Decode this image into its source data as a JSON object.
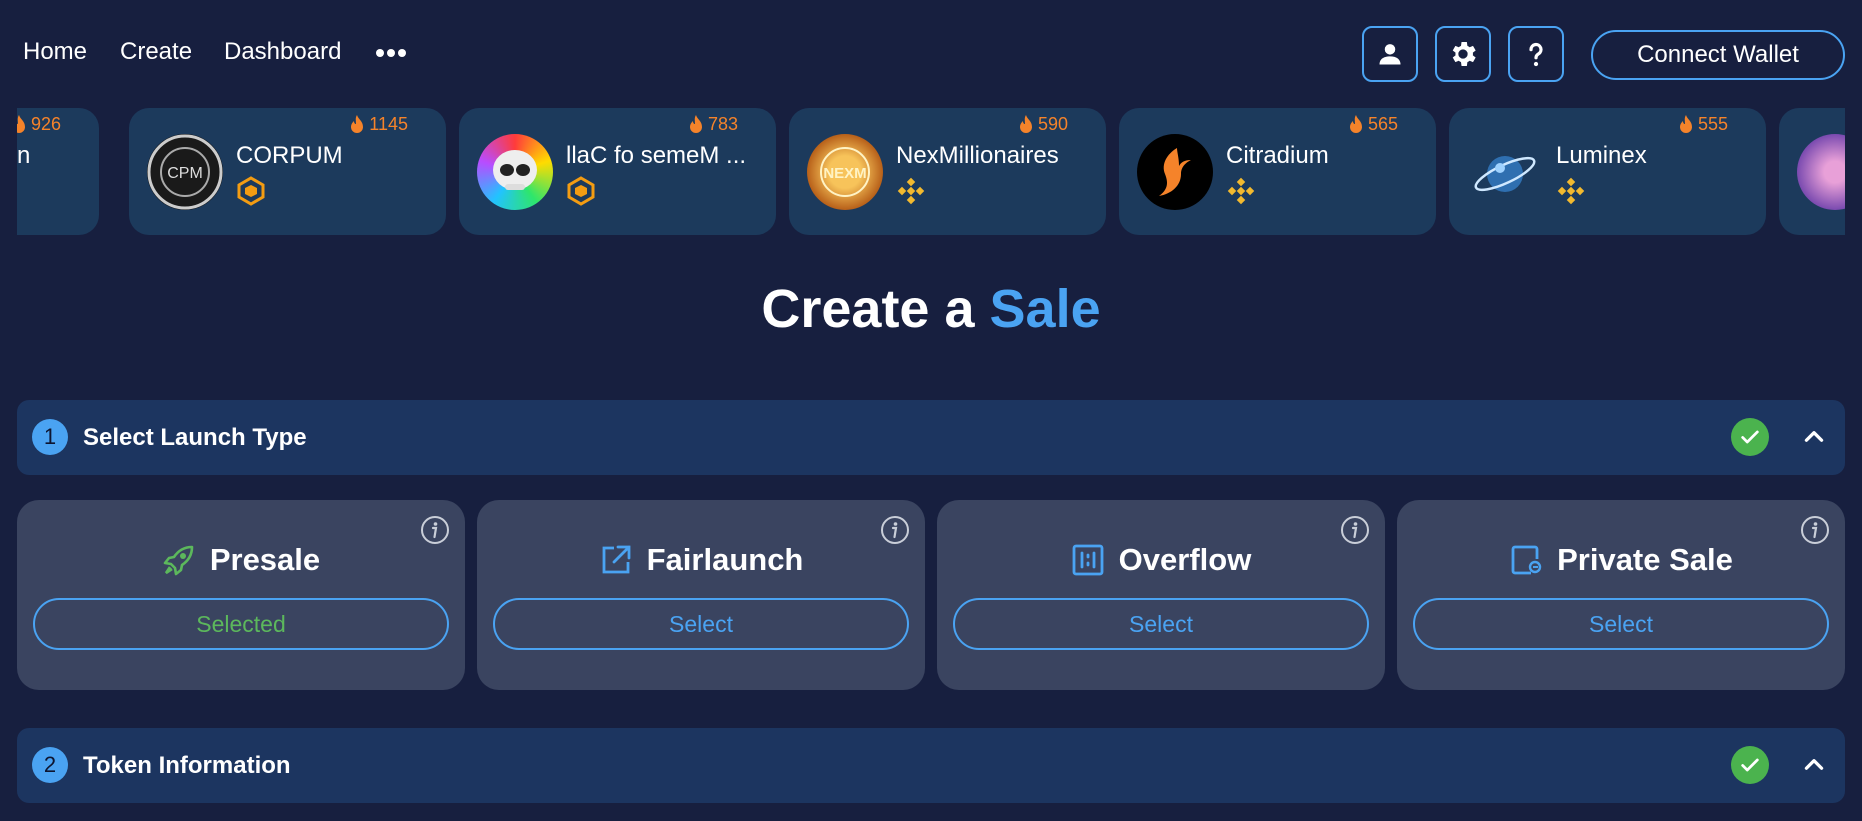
{
  "nav": {
    "links": [
      "Home",
      "Create",
      "Dashboard"
    ],
    "more_icon": "ellipsis-icon",
    "icons": [
      "user-icon",
      "gear-icon",
      "help-icon"
    ],
    "connect_wallet": "Connect Wallet"
  },
  "trending": [
    {
      "name": "n",
      "count": "926",
      "chain_icon": "chain-icon"
    },
    {
      "name": "CORPUM",
      "count": "1145",
      "chain_icon": "chain-icon"
    },
    {
      "name": "llaC fo semeM ...",
      "count": "783",
      "chain_icon": "chain-icon"
    },
    {
      "name": "NexMillionaires",
      "count": "590",
      "chain_icon": "bnb-icon"
    },
    {
      "name": "Citradium",
      "count": "565",
      "chain_icon": "bnb-icon"
    },
    {
      "name": "Luminex",
      "count": "555",
      "chain_icon": "bnb-icon"
    }
  ],
  "title": {
    "part1": "Create a ",
    "accent": "Sale"
  },
  "sections": [
    {
      "step": "1",
      "title": "Select Launch Type",
      "completed": true
    },
    {
      "step": "2",
      "title": "Token Information",
      "completed": true
    }
  ],
  "launch_types": [
    {
      "name": "Presale",
      "button": "Selected",
      "icon": "rocket-icon",
      "selected": true
    },
    {
      "name": "Fairlaunch",
      "button": "Select",
      "icon": "external-link-icon",
      "selected": false
    },
    {
      "name": "Overflow",
      "button": "Select",
      "icon": "overflow-icon",
      "selected": false
    },
    {
      "name": "Private Sale",
      "button": "Select",
      "icon": "private-sale-icon",
      "selected": false
    }
  ],
  "colors": {
    "background": "#171f3f",
    "accent": "#4aa3f2",
    "card": "#1c3a5c",
    "section": "#1c3560",
    "launch_card": "#3a4460",
    "hot": "#f5832a",
    "success": "#4bb34e"
  }
}
